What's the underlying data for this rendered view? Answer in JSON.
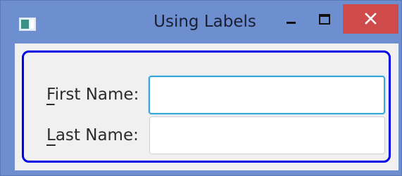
{
  "window": {
    "title": "Using Labels",
    "title_bar_color": "#6d8fd0",
    "close_button_color": "#cf4b4b",
    "focus_frame_color": "#0000e6"
  },
  "form": {
    "first_name": {
      "label_mnemonic": "F",
      "label_rest": "irst Name:",
      "value": ""
    },
    "last_name": {
      "label_mnemonic": "L",
      "label_rest": "ast Name:",
      "value": ""
    }
  },
  "icons": {
    "app": "window-app-icon",
    "minimize": "minimize-icon",
    "maximize": "maximize-icon",
    "close": "close-icon"
  }
}
